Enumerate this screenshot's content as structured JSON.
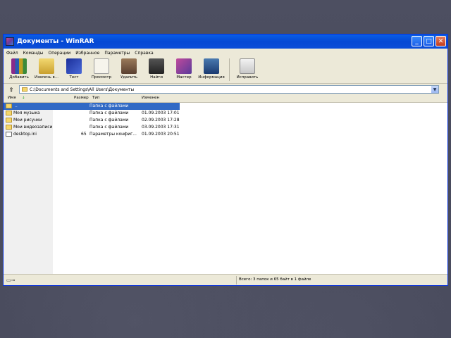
{
  "window": {
    "title": "Документы - WinRAR"
  },
  "menu": [
    "Файл",
    "Команды",
    "Операции",
    "Избранное",
    "Параметры",
    "Справка"
  ],
  "toolbar": [
    {
      "label": "Добавить",
      "icon": "books-add-icon"
    },
    {
      "label": "Извлечь в...",
      "icon": "extract-folder-icon"
    },
    {
      "label": "Тест",
      "icon": "test-book-icon"
    },
    {
      "label": "Просмотр",
      "icon": "view-glasses-icon"
    },
    {
      "label": "Удалить",
      "icon": "delete-icon"
    },
    {
      "label": "Найти",
      "icon": "find-binoculars-icon"
    },
    {
      "label": "Мастер",
      "icon": "wizard-icon"
    },
    {
      "label": "Информация",
      "icon": "info-icon"
    },
    {
      "label": "Исправить",
      "icon": "repair-kit-icon"
    }
  ],
  "address": {
    "path": "C:\\Documents and Settings\\All Users\\Документы"
  },
  "columns": {
    "name": "Имя",
    "size": "Размер",
    "type": "Тип",
    "modified": "Изменен"
  },
  "files": [
    {
      "name": "..",
      "size": "",
      "type": "Папка с файлами",
      "modified": ""
    },
    {
      "name": "Моя музыка",
      "size": "",
      "type": "Папка с файлами",
      "modified": "01.09.2003 17:01"
    },
    {
      "name": "Мои рисунки",
      "size": "",
      "type": "Папка с файлами",
      "modified": "02.09.2003 17:28"
    },
    {
      "name": "Мои видеозаписи",
      "size": "",
      "type": "Папка с файлами",
      "modified": "03.09.2003 17:31"
    },
    {
      "name": "desktop.ini",
      "size": "65",
      "type": "Параметры конфиг...",
      "modified": "01.09.2003 20:51"
    }
  ],
  "status": {
    "text": "Всего: 3 папок и 65 байт в 1 файле"
  },
  "colors": {
    "titlebar": "#0548d4",
    "selection": "#316ac5",
    "background": "#4a4c5e"
  }
}
